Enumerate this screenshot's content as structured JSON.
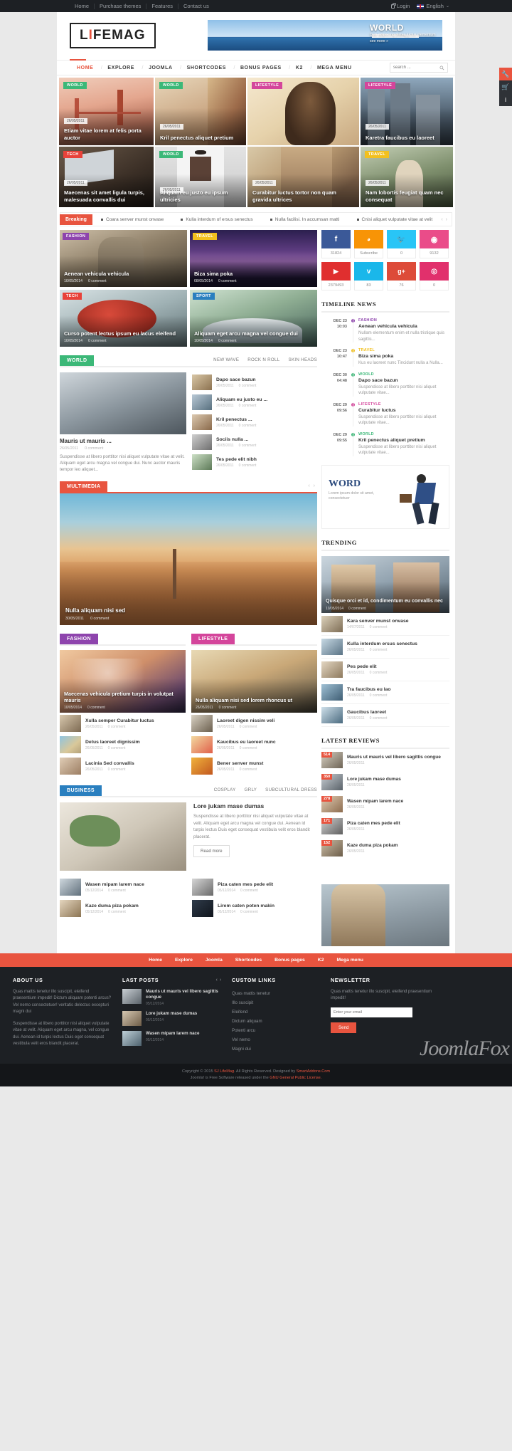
{
  "topbar": {
    "links": [
      "Home",
      "Purchase themes",
      "Features",
      "Contact us"
    ],
    "login": "Login",
    "language": "English"
  },
  "header": {
    "logo_left": "L",
    "logo_i": "I",
    "logo_right": "FEMAG",
    "banner": {
      "title": "WORLD",
      "sub": "Duis adipiscing platea luctus elementum",
      "more": "see more »"
    }
  },
  "nav": {
    "items": [
      "HOME",
      "EXPLORE",
      "JOOMLA",
      "SHORTCODES",
      "BONUS PAGES",
      "K2",
      "MEGA MENU"
    ],
    "active": "HOME",
    "search_placeholder": "search ..."
  },
  "featured": [
    {
      "cat": "WORLD",
      "cat_color": "#3cb878",
      "date": "26/05/2011",
      "title": "Etiam vitae lorem at felis porta auctor"
    },
    {
      "cat": "WORLD",
      "cat_color": "#3cb878",
      "date": "26/05/2011",
      "title": "Kril penectus aliquet pretium"
    },
    {
      "cat": "LIFESTYLE",
      "cat_color": "#d4459b",
      "date": "",
      "title": ""
    },
    {
      "cat": "LIFESTYLE",
      "cat_color": "#d4459b",
      "date": "26/05/2011",
      "title": "Karetra faucibus eu laoreet"
    },
    {
      "cat": "TECH",
      "cat_color": "#e8423a",
      "date": "26/05/2011",
      "title": "Maecenas sit amet ligula turpis, malesuada convallis dui"
    },
    {
      "cat": "WORLD",
      "cat_color": "#3cb878",
      "date": "26/05/2011",
      "title": "Aliquam eu justo eu ipsum ultricies"
    },
    {
      "cat": "",
      "cat_color": "",
      "date": "26/05/2011",
      "title": "Curabitur luctus tortor non quam gravida ultrices"
    },
    {
      "cat": "TRAVEL",
      "cat_color": "#f2c01e",
      "date": "26/05/2011",
      "title": "Nam lobortis feugiat quam nec consequat"
    }
  ],
  "breaking": {
    "label": "Breaking",
    "items": [
      "Coara senver munst onvase",
      "Kulla interdum of ersus senectus",
      "Nulla facilisi. In accumsan matti",
      "Cnisi aliquet vulputate vitae at velit"
    ]
  },
  "tiles": [
    {
      "cat": "FASHION",
      "cat_color": "#8e44ad",
      "title": "Aenean vehicula vehicula",
      "date": "10/05/2014",
      "comments": "0 comment"
    },
    {
      "cat": "TRAVEL",
      "cat_color": "#f2c01e",
      "title": "Biza sima poka",
      "date": "08/05/2014",
      "comments": "0 comment"
    },
    {
      "cat": "TECH",
      "cat_color": "#e8423a",
      "title": "Curso potent lectus ipsum eu lacus eleifend",
      "date": "10/05/2014",
      "comments": "0 comment"
    },
    {
      "cat": "SPORT",
      "cat_color": "#2a7fbf",
      "title": "Aliquam eget arcu magna vel congue dui",
      "date": "10/05/2014",
      "comments": "0 comment"
    }
  ],
  "world_section": {
    "tag": "WORLD",
    "tag_color": "#3cb878",
    "tabs": [
      "NEW WAVE",
      "ROCK N ROLL",
      "SKIN HEADS"
    ],
    "main": {
      "title": "Mauris ut mauris ...",
      "date": "26/05/2011",
      "comments": "0 comment",
      "excerpt": "Suspendisse at libero porttitor nisi aliquet vulputate vitae at velit. Aliquam eget arcu magna vel congue dui. Nunc auctor mauris tempor leo aliquet..."
    },
    "list": [
      {
        "title": "Dapo sace bazun",
        "date": "26/05/2011",
        "comments": "0 comment"
      },
      {
        "title": "Aliquam eu justo eu ...",
        "date": "26/05/2011",
        "comments": "0 comment"
      },
      {
        "title": "Kril penectus ...",
        "date": "26/05/2011",
        "comments": "0 comment"
      },
      {
        "title": "Sociis nulla ...",
        "date": "26/05/2011",
        "comments": "0 comment"
      },
      {
        "title": "Tes pede elit nibh",
        "date": "26/05/2011",
        "comments": "0 comment"
      }
    ]
  },
  "multimedia": {
    "tag": "MULTIMEDIA",
    "tag_color": "#e8543f",
    "title": "Nulla aliquam nisi sed",
    "date": "30/05/2011",
    "comments": "0 comment"
  },
  "fashion_col": {
    "tag": "FASHION",
    "tag_color": "#8e44ad",
    "big": {
      "title": "Maecenas vehicula pretium turpis in volutpat mauris",
      "date": "10/05/2014",
      "comments": "0 comment"
    },
    "list": [
      {
        "title": "Xulla semper Curabitur luctus",
        "date": "26/05/2011",
        "comments": "0 comment"
      },
      {
        "title": "Detus laoreet dignissim",
        "date": "26/05/2011",
        "comments": "0 comment"
      },
      {
        "title": "Lacinia Sed convallis",
        "date": "26/05/2011",
        "comments": "0 comment"
      }
    ]
  },
  "lifestyle_col": {
    "tag": "LIFESTYLE",
    "tag_color": "#d4459b",
    "big": {
      "title": "Nulla aliquam nisi sed lorem rhoncus ut",
      "date": "26/05/2011",
      "comments": "0 comment"
    },
    "list": [
      {
        "title": "Laoreet digen nissim veli",
        "date": "26/05/2011",
        "comments": "0 comment"
      },
      {
        "title": "Kaucibus eu laoreet nunc",
        "date": "26/05/2011",
        "comments": "0 comment"
      },
      {
        "title": "Bener senver munst",
        "date": "26/05/2011",
        "comments": "0 comment"
      }
    ]
  },
  "business": {
    "tag": "BUSINESS",
    "tag_color": "#2a7fbf",
    "tabs": [
      "COSPLAY",
      "GRLY",
      "SUBCULTURAL DRESS"
    ],
    "lead": {
      "title": "Lore jukam mase dumas",
      "body": "Suspendisse at libero porttitor nisi aliquet vulputate vitae at velit. Aliquam eget arcu magna vel congue dui. Aenean id turpis lectus Duis eget consequat vestibula velit eros blandit placerat.",
      "readmore": "Read more"
    },
    "list_left": [
      {
        "title": "Wasen mipam larem nace",
        "date": "05/12/2014",
        "comments": "0 comment"
      },
      {
        "title": "Kaze duma piza pokam",
        "date": "05/12/2014",
        "comments": "0 comment"
      }
    ],
    "list_right": [
      {
        "title": "Piza caten mes pede elit",
        "date": "05/12/2014",
        "comments": "0 comment"
      },
      {
        "title": "Lirem caten poten makin",
        "date": "05/12/2014",
        "comments": "0 comment"
      }
    ]
  },
  "social": [
    {
      "name": "facebook-icon",
      "glyph": "f",
      "color": "#3b5998",
      "count": "31824"
    },
    {
      "name": "rss-icon",
      "glyph": "◕",
      "color": "#f89406",
      "count": "Subscribe"
    },
    {
      "name": "twitter-icon",
      "glyph": "ᵗ",
      "color": "#29c5f6",
      "count": "0"
    },
    {
      "name": "dribbble-icon",
      "glyph": "●",
      "color": "#ea4c89",
      "count": "9132"
    },
    {
      "name": "youtube-icon",
      "glyph": "▶",
      "color": "#e02f2f",
      "count": "2379493"
    },
    {
      "name": "vimeo-icon",
      "glyph": "v",
      "color": "#1ab7ea",
      "count": "83"
    },
    {
      "name": "google-plus-icon",
      "glyph": "g+",
      "color": "#dd4b39",
      "count": "76"
    },
    {
      "name": "instagram-icon",
      "glyph": "◎",
      "color": "#e1306c",
      "count": "0"
    }
  ],
  "timeline": {
    "title": "TIMELINE NEWS",
    "items": [
      {
        "day": "DEC 23",
        "time": "10:03",
        "dot": "#8e44ad",
        "cat": "FASHION",
        "cat_color": "#8e44ad",
        "title": "Aenean vehicula vehicula",
        "excerpt": "Nullam elementum enim et nulla tristique quis sagittis..."
      },
      {
        "day": "DEC 23",
        "time": "10:47",
        "dot": "#f2c01e",
        "cat": "TRAVEL",
        "cat_color": "#f2c01e",
        "title": "Biza sima poka",
        "excerpt": "Kus eu laoreet nunc Tincidunt nulla a Nulla..."
      },
      {
        "day": "DEC 30",
        "time": "04:48",
        "dot": "#3cb878",
        "cat": "WORLD",
        "cat_color": "#3cb878",
        "title": "Dapo sace bazun",
        "excerpt": "Suspendisse at libero porttitor nisi aliquet vulputate vitae..."
      },
      {
        "day": "DEC 29",
        "time": "09:56",
        "dot": "#d4459b",
        "cat": "LIFESTYLE",
        "cat_color": "#d4459b",
        "title": "Curabitur luctus",
        "excerpt": "Suspendisse at libero porttitor nisi aliquet vulputate vitae..."
      },
      {
        "day": "DEC 29",
        "time": "09:55",
        "dot": "#3cb878",
        "cat": "WORLD",
        "cat_color": "#3cb878",
        "title": "Kril penectus aliquet pretium",
        "excerpt": "Suspendisse at libero porttitor nisi aliquet vulputate vitae..."
      }
    ]
  },
  "wordad": {
    "title": "WORD",
    "sub": "Lorem ipsum dolor sit amet, consectetuer"
  },
  "trending": {
    "title": "TRENDING",
    "big": {
      "title": "Quisque orci et id, condimentum eu convallis nec",
      "date": "10/05/2014",
      "comments": "0 comment"
    },
    "list": [
      {
        "title": "Kara senver munst onvase",
        "date": "14/07/2011",
        "comments": "0 comment"
      },
      {
        "title": "Kulla interdum ersus senectus",
        "date": "26/05/2011",
        "comments": "0 comment"
      },
      {
        "title": "Pes pede elit",
        "date": "26/05/2011",
        "comments": "0 comment"
      },
      {
        "title": "Tra faucibus eu lao",
        "date": "26/05/2011",
        "comments": "0 comment"
      },
      {
        "title": "Gaucibus laoreet",
        "date": "26/05/2011",
        "comments": "0 comment"
      }
    ]
  },
  "reviews": {
    "title": "LATEST REVIEWS",
    "items": [
      {
        "score": "514",
        "title": "Mauris ut mauris vel libero sagittis congue",
        "date": "26/05/2011"
      },
      {
        "score": "350",
        "title": "Lore jukam mase dumas",
        "date": "26/05/2011"
      },
      {
        "score": "278",
        "title": "Wasen mipam larem nace",
        "date": "26/05/2011"
      },
      {
        "score": "171",
        "title": "Piza caten mes pede elit",
        "date": "26/05/2011"
      },
      {
        "score": "152",
        "title": "Kaze duma piza pokam",
        "date": "26/05/2011"
      }
    ]
  },
  "footer_nav": [
    "Home",
    "Explore",
    "Joomla",
    "Shortcodes",
    "Bonus pages",
    "K2",
    "Mega menu"
  ],
  "footer": {
    "about": {
      "title": "ABOUT US",
      "p1": "Quas mattis tenetur illo suscipit, eleifend praesentium impedit! Dictum aliquam potenti arcus? Vel nemo consectetuer! veritatis delectus excepturi magni dui",
      "p2": "Suspendisse at libero porttitor nisi aliquet vulputate vitae at velit. Aliquam eget arcu magna, vel congue dui. Aenean id turpis lectus Duis eget consequat vestibula velit eros blandit placerat."
    },
    "last_posts": {
      "title": "LAST POSTS",
      "items": [
        {
          "title": "Mauris ut mauris vel libero sagittis congue",
          "date": "05/12/2014"
        },
        {
          "title": "Lore jukam mase dumas",
          "date": "05/12/2014"
        },
        {
          "title": "Wasen mipam larem nace",
          "date": "05/12/2014"
        }
      ]
    },
    "custom_links": {
      "title": "CUSTOM LINKS",
      "items": [
        "Quas mattis tenetur",
        "Illo suscipit",
        "Eleifend",
        "Dictum aliquam",
        "Potenti arcu",
        "Vel nemo",
        "Magni dui"
      ]
    },
    "newsletter": {
      "title": "NEWSLETTER",
      "desc": "Quas mattis tenetur illo suscipit, eleifend praesentium impedit!",
      "placeholder": "Enter your email",
      "button": "Send"
    }
  },
  "copyright": {
    "line1_pre": "Copyright © 2015 ",
    "line1_brand": "SJ LifeMag",
    "line1_mid": ". All Rights Reserved. Designed by ",
    "line1_link": "SmartAddons.Com",
    "line2_pre": "Joomla! is Free Software released under the ",
    "line2_link": "GNU General Public License."
  },
  "watermark": "JoomlaFox",
  "side_buttons": [
    "wrench-icon",
    "cart-icon",
    "info-icon"
  ]
}
